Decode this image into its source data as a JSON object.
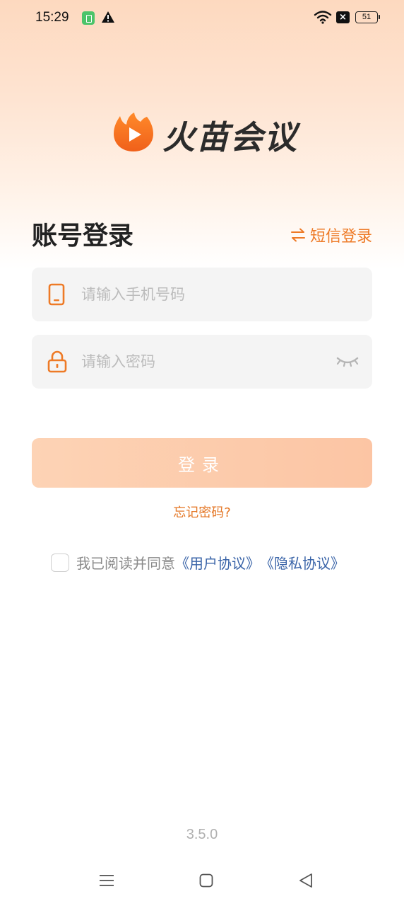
{
  "status_bar": {
    "time": "15:29",
    "battery": "51",
    "icons": [
      "app-notification-icon",
      "warning-icon",
      "wifi-icon",
      "no-sim-icon",
      "battery-icon"
    ]
  },
  "app": {
    "name": "火苗会议",
    "brand_color": "#ee7a26"
  },
  "login": {
    "title": "账号登录",
    "switch_label": "短信登录",
    "phone_placeholder": "请输入手机号码",
    "phone_value": "",
    "password_placeholder": "请输入密码",
    "password_value": "",
    "submit_label": "登录",
    "forgot_label": "忘记密码?"
  },
  "agreement": {
    "prefix": "我已阅读并同意",
    "user_agreement": "《用户协议》",
    "privacy_policy": "《隐私协议》",
    "checked": false
  },
  "footer": {
    "version": "3.5.0"
  },
  "nav": {
    "icons": [
      "menu-icon",
      "home-icon",
      "back-icon"
    ]
  }
}
